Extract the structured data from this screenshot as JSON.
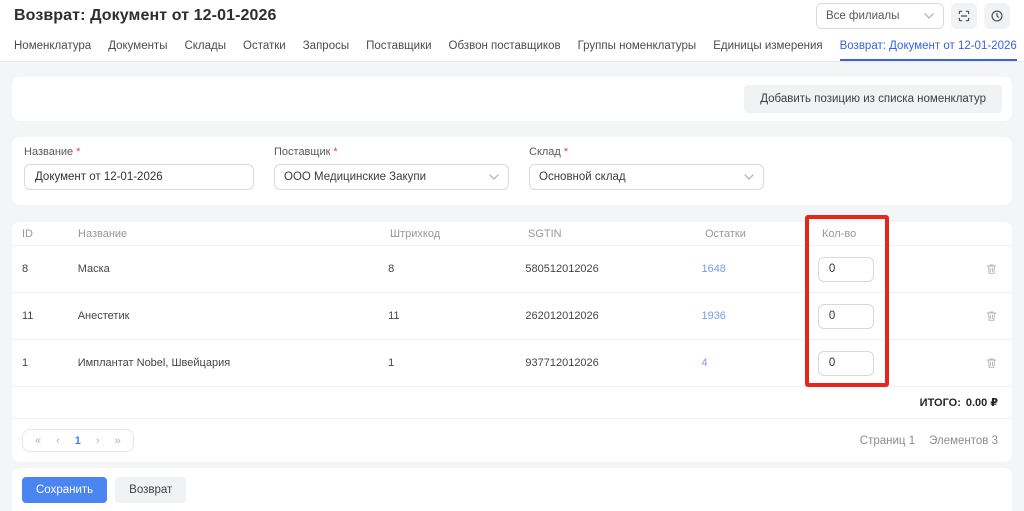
{
  "header": {
    "title": "Возврат: Документ от 12-01-2026",
    "branch_filter": {
      "value": "Все филиалы"
    }
  },
  "tabs": [
    {
      "label": "Номенклатура"
    },
    {
      "label": "Документы"
    },
    {
      "label": "Склады"
    },
    {
      "label": "Остатки"
    },
    {
      "label": "Запросы"
    },
    {
      "label": "Поставщики"
    },
    {
      "label": "Обзвон поставщиков"
    },
    {
      "label": "Группы номенклатуры"
    },
    {
      "label": "Единицы измерения"
    },
    {
      "label": "Возврат: Документ от 12-01-2026",
      "active": true
    }
  ],
  "toolbar": {
    "add_position_label": "Добавить позицию из списка номенклатур"
  },
  "form": {
    "required_mark": "*",
    "name": {
      "label": "Название",
      "value": "Документ от 12-01-2026"
    },
    "supplier": {
      "label": "Поставщик",
      "value": "ООО Медицинские Закупи"
    },
    "warehouse": {
      "label": "Склад",
      "value": "Основной склад"
    }
  },
  "table": {
    "columns": {
      "id": "ID",
      "name": "Название",
      "barcode": "Штрихкод",
      "sgtin": "SGTIN",
      "stock": "Остатки",
      "qty": "Кол-во"
    },
    "rows": [
      {
        "id": "8",
        "name": "Маска",
        "barcode": "8",
        "sgtin": "580512012026",
        "stock": "1648",
        "qty": "0"
      },
      {
        "id": "11",
        "name": "Анестетик",
        "barcode": "11",
        "sgtin": "262012012026",
        "stock": "1936",
        "qty": "0"
      },
      {
        "id": "1",
        "name": "Имплантат Nobel, Швейцария",
        "barcode": "1",
        "sgtin": "937712012026",
        "stock": "4",
        "qty": "0"
      }
    ],
    "total": {
      "label": "ИТОГО:",
      "value": "0.00 ₽"
    }
  },
  "pagination": {
    "first": "«",
    "prev": "‹",
    "page": "1",
    "next": "›",
    "last": "»",
    "pages_summary": "Страниц 1",
    "items_summary": "Элементов 3"
  },
  "footer": {
    "save_label": "Сохранить",
    "return_label": "Возврат"
  },
  "icons": [
    "scan-icon",
    "clock-icon",
    "chevron-down-icon",
    "trash-icon"
  ],
  "colors": {
    "accent": "#3662E3",
    "link": "#7E97F3",
    "primary_button": "#4B84F3",
    "annotation": "#E8251B"
  }
}
